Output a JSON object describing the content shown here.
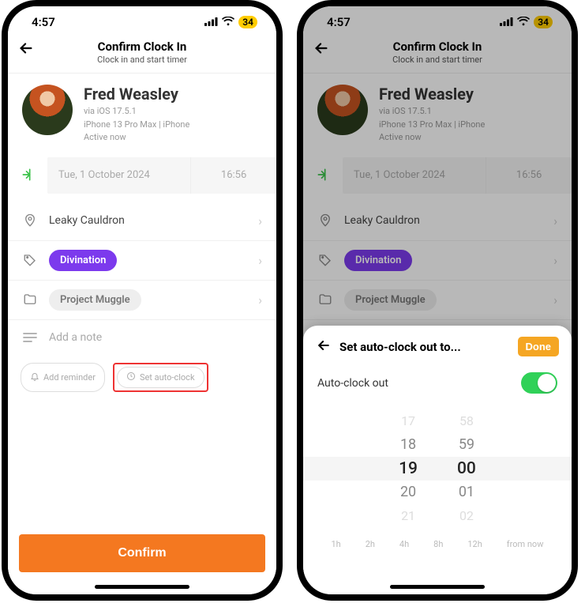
{
  "status": {
    "time": "4:57",
    "battery": "34"
  },
  "header": {
    "title": "Confirm Clock In",
    "subtitle": "Clock in and start timer"
  },
  "user": {
    "name": "Fred Weasley",
    "line1": "via iOS 17.5.1",
    "line2": "iPhone 13 Pro Max | iPhone",
    "line3": "Active now"
  },
  "clockin": {
    "date": "Tue, 1 October 2024",
    "time": "16:56"
  },
  "location": {
    "label": "Leaky Cauldron"
  },
  "tag": {
    "label": "Divination"
  },
  "project": {
    "label": "Project Muggle"
  },
  "note": {
    "placeholder": "Add a note"
  },
  "chips": {
    "reminder": "Add reminder",
    "autoclock": "Set auto-clock"
  },
  "confirm": {
    "label": "Confirm"
  },
  "sheet": {
    "title": "Set auto-clock out to...",
    "done": "Done",
    "toggle_label": "Auto-clock out",
    "picker": {
      "hours": [
        "17",
        "18",
        "19",
        "20",
        "21"
      ],
      "minutes": [
        "58",
        "59",
        "00",
        "01",
        "02"
      ]
    },
    "quick": [
      "1h",
      "2h",
      "4h",
      "8h",
      "12h",
      "from now"
    ]
  }
}
